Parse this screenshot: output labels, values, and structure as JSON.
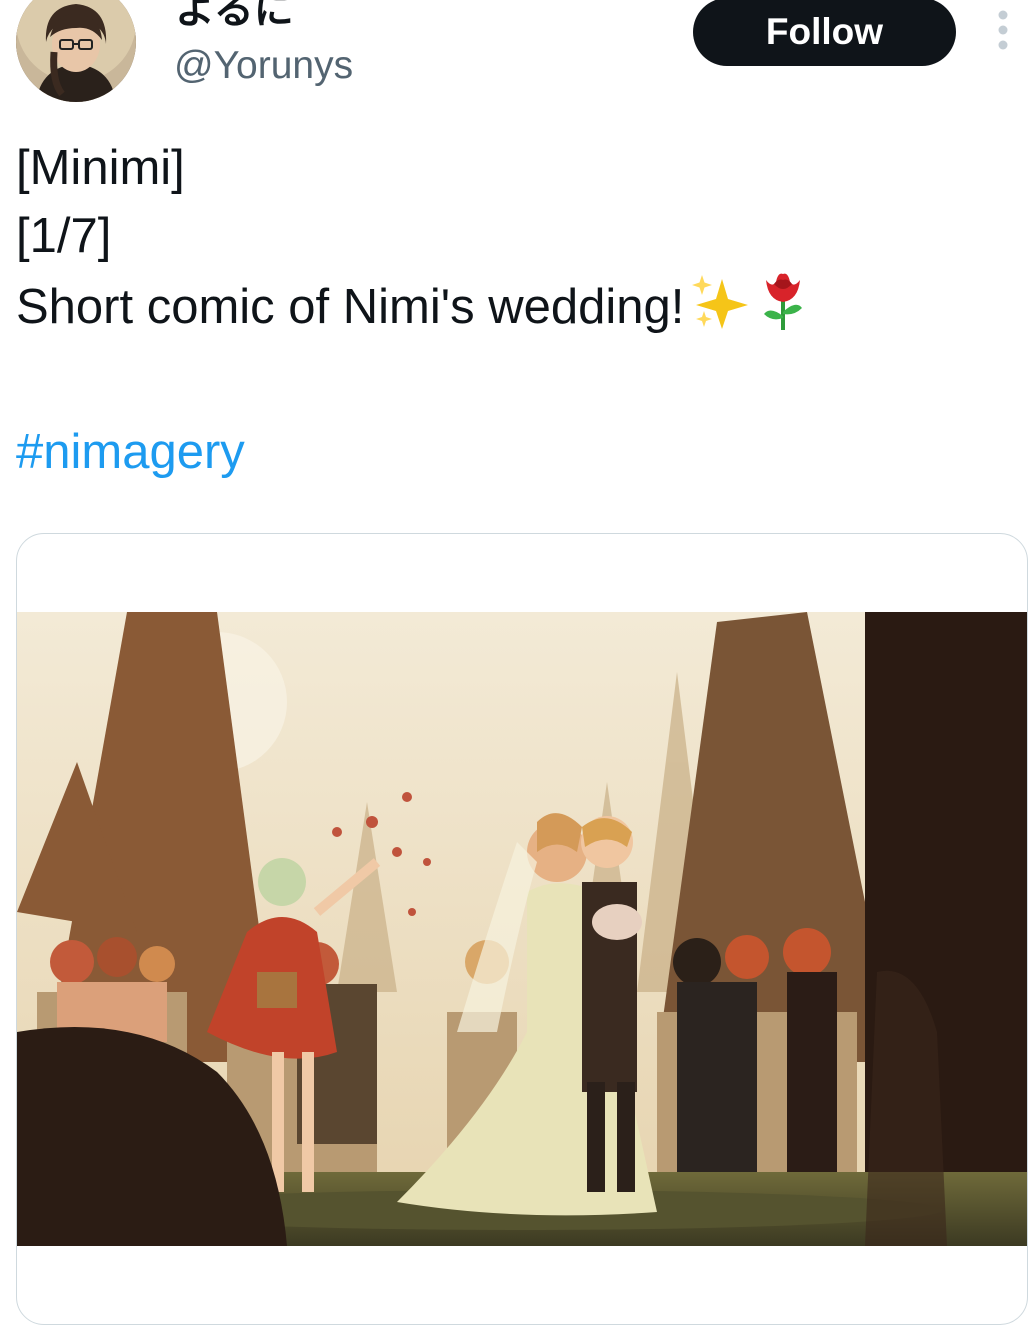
{
  "author": {
    "display_name": "よるに",
    "handle": "@Yorunys"
  },
  "follow_label": "Follow",
  "tweet": {
    "line1": "[Minimi]",
    "line2": "[1/7]",
    "line3": "Short comic of Nimi's wedding!",
    "hashtag": "#nimagery",
    "emojis": [
      "sparkles-icon",
      "rose-icon"
    ]
  },
  "colors": {
    "hashtag": "#1d9bf0",
    "follow_bg": "#0f1419",
    "handle": "#536471"
  }
}
